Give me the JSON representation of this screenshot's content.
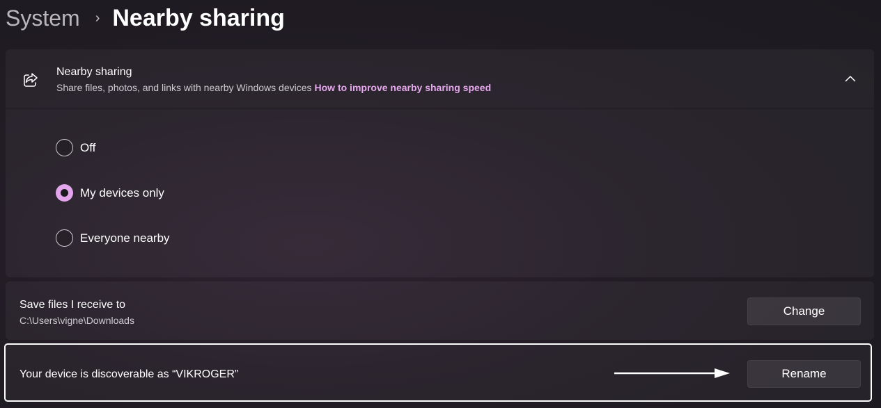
{
  "breadcrumb": {
    "parent": "System",
    "separator": "›",
    "current": "Nearby sharing"
  },
  "nearby_sharing": {
    "icon": "share-icon",
    "title": "Nearby sharing",
    "description": "Share files, photos, and links with nearby Windows devices",
    "link": "How to improve nearby sharing speed",
    "expanded": true,
    "options": [
      {
        "label": "Off",
        "selected": false
      },
      {
        "label": "My devices only",
        "selected": true
      },
      {
        "label": "Everyone nearby",
        "selected": false
      }
    ]
  },
  "save_files": {
    "title": "Save files I receive to",
    "path": "C:\\Users\\vigne\\Downloads",
    "button": "Change"
  },
  "device": {
    "text": "Your device is discoverable as “VIKROGER”",
    "button": "Rename"
  },
  "colors": {
    "accent": "#e3a6ec",
    "link": "#e7a8ee",
    "highlight_border": "#ffffff"
  }
}
